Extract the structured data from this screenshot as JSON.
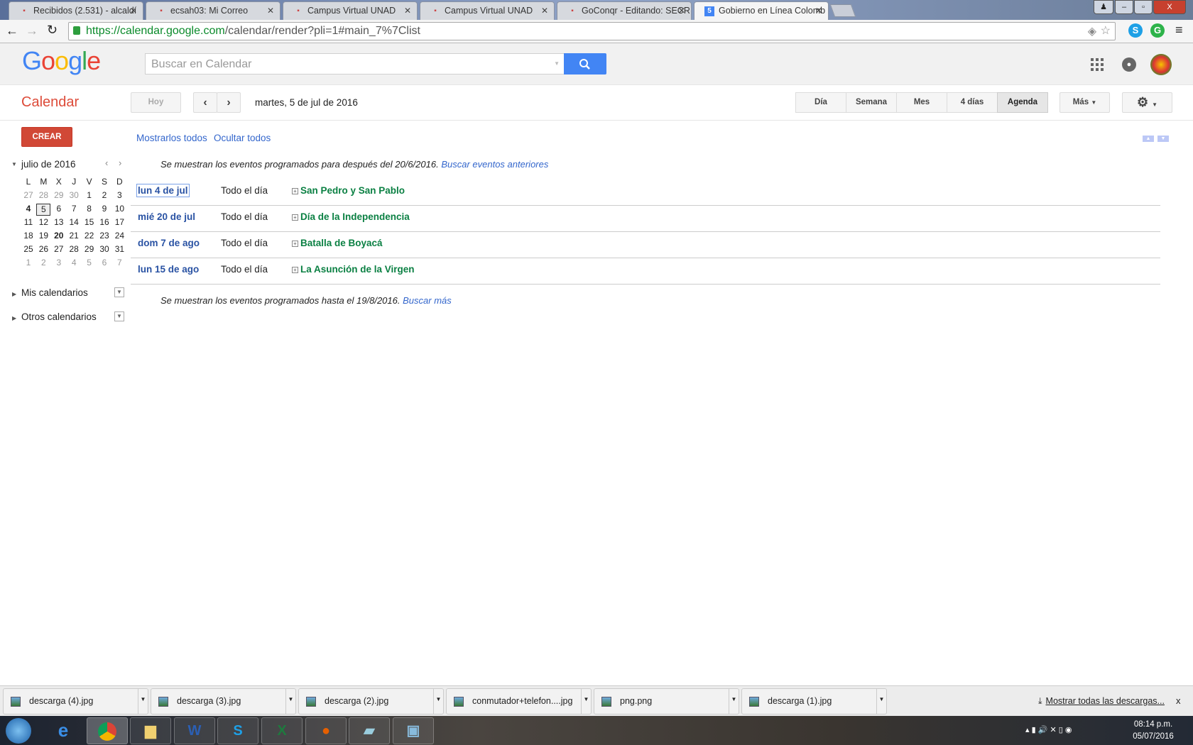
{
  "browser": {
    "tabs": [
      {
        "label": "Recibidos (2.531) - alcaldí",
        "icon": "gmail-icon"
      },
      {
        "label": "ecsah03: Mi Correo",
        "icon": "mail-icon"
      },
      {
        "label": "Campus Virtual UNAD",
        "icon": "moodle-icon"
      },
      {
        "label": "Campus Virtual UNAD",
        "icon": "moodle-icon"
      },
      {
        "label": "GoConqr - Editando: SECR",
        "icon": "goconqr-icon"
      },
      {
        "label": "Gobierno en Línea Colomb",
        "icon": "calendar-icon",
        "active": true
      }
    ],
    "url": "https://calendar.google.com/calendar/render?pli=1#main_7%7Clist",
    "url_host": "https://calendar.google.com",
    "url_path": "/calendar/render?pli=1#main_7%7Clist"
  },
  "header": {
    "logo": "Google",
    "search_placeholder": "Buscar en Calendar"
  },
  "calbar": {
    "app_title": "Calendar",
    "today": "Hoy",
    "current_date": "martes, 5 de jul de 2016",
    "views": [
      "Día",
      "Semana",
      "Mes",
      "4 días",
      "Agenda"
    ],
    "active_view": "Agenda",
    "more": "Más"
  },
  "sidebar": {
    "create": "CREAR",
    "month_title": "julio de 2016",
    "weekdays": [
      "L",
      "M",
      "X",
      "J",
      "V",
      "S",
      "D"
    ],
    "weeks": [
      [
        "27",
        "28",
        "29",
        "30",
        "1",
        "2",
        "3"
      ],
      [
        "4",
        "5",
        "6",
        "7",
        "8",
        "9",
        "10"
      ],
      [
        "11",
        "12",
        "13",
        "14",
        "15",
        "16",
        "17"
      ],
      [
        "18",
        "19",
        "20",
        "21",
        "22",
        "23",
        "24"
      ],
      [
        "25",
        "26",
        "27",
        "28",
        "29",
        "30",
        "31"
      ],
      [
        "1",
        "2",
        "3",
        "4",
        "5",
        "6",
        "7"
      ]
    ],
    "my_calendars": "Mis calendarios",
    "other_calendars": "Otros calendarios"
  },
  "agenda": {
    "show_all": "Mostrarlos todos",
    "hide_all": "Ocultar todos",
    "top_note": "Se muestran los eventos programados para después del 20/6/2016.",
    "top_link": "Buscar eventos anteriores",
    "events": [
      {
        "date": "lun 4 de jul",
        "time": "Todo el día",
        "title": "San Pedro y San Pablo"
      },
      {
        "date": "mié 20 de jul",
        "time": "Todo el día",
        "title": "Día de la Independencia"
      },
      {
        "date": "dom 7 de ago",
        "time": "Todo el día",
        "title": "Batalla de Boyacá"
      },
      {
        "date": "lun 15 de ago",
        "time": "Todo el día",
        "title": "La Asunción de la Virgen"
      }
    ],
    "bottom_note": "Se muestran los eventos programados hasta el 19/8/2016.",
    "bottom_link": "Buscar más"
  },
  "downloads": {
    "items": [
      "descarga (4).jpg",
      "descarga (3).jpg",
      "descarga (2).jpg",
      "conmutador+telefon....jpg",
      "png.png",
      "descarga (1).jpg"
    ],
    "show_all": "Mostrar todas las descargas...",
    "close": "x"
  },
  "taskbar": {
    "time": "08:14 p.m.",
    "date": "05/07/2016"
  },
  "colors": {
    "accent_red": "#dd4b39",
    "link_blue": "#3366cc",
    "event_green": "#0b8043",
    "search_blue": "#4285f4"
  }
}
